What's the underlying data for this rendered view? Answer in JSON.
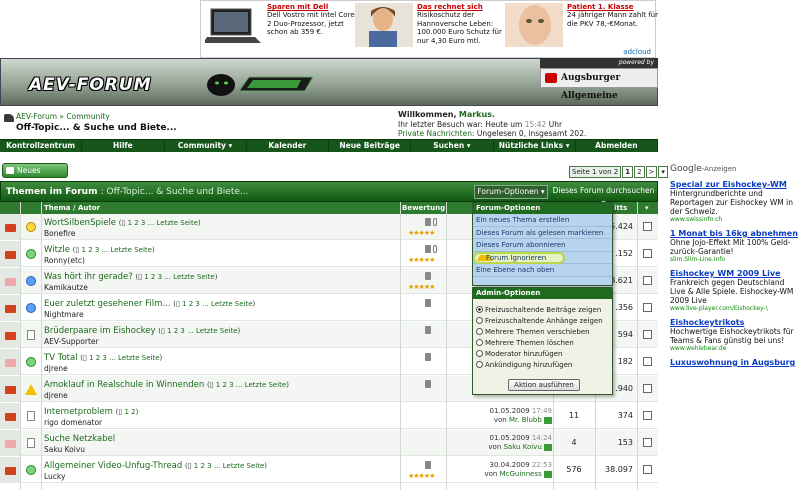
{
  "top_ads": [
    {
      "title": "Sparen mit Dell",
      "text": "Dell Vostro mit Intel Core 2 Duo-Prozessor, jetzt schon ab 359 €."
    },
    {
      "title": "Das rechnet sich",
      "text": "Risikoschutz der Hannoversche Leben: 100.000 Euro Schutz für nur 4,30 Euro mtl."
    },
    {
      "title": "Patient 1. Klasse",
      "text": "24 jähriger Mann zahlt für die PKV 78,-€Monat."
    }
  ],
  "adcloud": "adcloud",
  "header": {
    "logo": "AEV-FORUM",
    "powered_by": "powered by",
    "partner": "Augsburger Allgemeine"
  },
  "breadcrumb": {
    "path": "AEV-Forum » Community",
    "title": "Off-Topic... & Suche und Biete..."
  },
  "welcome": {
    "greeting": "Willkommen,",
    "user": "Markus.",
    "last_visit_label": "Ihr letzter Besuch war: Heute um",
    "last_visit_time": "15:42",
    "last_visit_suffix": "Uhr",
    "pm_label": "Private Nachrichten:",
    "pm_value": "Ungelesen 0, insgesamt 202."
  },
  "nav": [
    "Kontrollzentrum",
    "Hilfe",
    "Community ▾",
    "Kalender",
    "Neue Beiträge",
    "Suchen ▾",
    "Nützliche Links ▾",
    "Abmelden"
  ],
  "new_thread": "Neues Thema",
  "pager": {
    "info": "Seite 1 von 2",
    "pages": [
      "1",
      "2",
      ">",
      "▾"
    ]
  },
  "forum": {
    "title": "Themen im Forum",
    "name": ": Off-Topic... & Suche und Biete...",
    "options": "Forum-Optionen ▾",
    "search": "Dieses Forum durchsuchen ▾"
  },
  "columns": {
    "topic": "Thema / Autor",
    "rating": "Bewertung",
    "views": "itts"
  },
  "threads": [
    {
      "title": "WortSilbenSpiele",
      "pages": "1 2 3 ... Letzte Seite",
      "author": "Bonefire",
      "date": "",
      "time": "",
      "by": "",
      "replies": "",
      "views": "5.424",
      "icon": "smile"
    },
    {
      "title": "Witzle",
      "pages": "1 2 3 ... Letzte Seite",
      "author": "Ronny(etc)",
      "date": "",
      "time": "",
      "by": "",
      "replies": "",
      "views": ".152",
      "icon": "green"
    },
    {
      "title": "Was hört ihr gerade?",
      "pages": "1 2 3 ... Letzte Seite",
      "author": "Kamikautze",
      "date": "",
      "time": "",
      "by": "",
      "replies": "",
      "views": "8.621",
      "icon": "blue"
    },
    {
      "title": "Euer zuletzt gesehener Film...",
      "pages": "1 2 3 ... Letzte Seite",
      "author": "Nightmare",
      "date": "",
      "time": "",
      "by": "",
      "replies": "",
      "views": ".356",
      "icon": "blue"
    },
    {
      "title": "Brüderpaare im Eishockey",
      "pages": "1 2 3 ... Letzte Seite",
      "author": "AEV-Supporter",
      "date": "",
      "time": "",
      "by": "",
      "replies": "",
      "views": "594",
      "icon": "doc"
    },
    {
      "title": "TV Total",
      "pages": "1 2 3 ... Letzte Seite",
      "author": "djrene",
      "date": "",
      "time": "",
      "by": "",
      "replies": "",
      "views": "182",
      "icon": "green"
    },
    {
      "title": "Amoklauf in Realschule in Winnenden",
      "pages": "1 2 3 ... Letzte Seite",
      "author": "djrene",
      "date": "",
      "time": "",
      "by": "",
      "replies": "",
      "views": ".940",
      "icon": "warn"
    },
    {
      "title": "Internetproblem",
      "pages": "1 2",
      "author": "rigo domenator",
      "date": "01.05.2009",
      "time": "17:49",
      "by": "Mr. Blubb",
      "replies": "11",
      "views": "374",
      "icon": "doc"
    },
    {
      "title": "Suche Netzkabel",
      "pages": "",
      "author": "Saku Koivu",
      "date": "01.05.2009",
      "time": "14:24",
      "by": "Saku Koivu",
      "replies": "4",
      "views": "153",
      "icon": "doc"
    },
    {
      "title": "Allgemeiner Video-Unfug-Thread",
      "pages": "1 2 3 ... Letzte Seite",
      "author": "Lucky",
      "date": "30.04.2009",
      "time": "22:53",
      "by": "McGuinness",
      "replies": "576",
      "views": "38.097",
      "icon": "green"
    }
  ],
  "forum_menu": {
    "header": "Forum-Optionen",
    "items": [
      "Ein neues Thema erstellen",
      "Dieses Forum als gelesen markieren",
      "Dieses Forum abonnieren",
      "Forum Ignorieren",
      "Eine Ebene nach oben"
    ]
  },
  "admin_menu": {
    "header": "Admin-Optionen",
    "options": [
      "Freizuschaltende Beiträge zeigen",
      "Freizuschaltende Anhänge zeigen",
      "Mehrere Themen verschieben",
      "Mehrere Themen löschen",
      "Moderator hinzufügen",
      "Ankündigung hinzufügen"
    ],
    "button": "Aktion ausführen"
  },
  "google": {
    "brand": "Google",
    "suffix": "-Anzeigen"
  },
  "side_ads": [
    {
      "title": "Special zur Eishockey-WM",
      "body": "Hintergrundberichte und Reportagen zur Eishockey WM in der Schweiz.",
      "url": "www.swissinfo.ch"
    },
    {
      "title": "1 Monat bis 16kg abnehmen",
      "body": "Ohne Jojo-Effekt Mit 100% Geld-zurück-Garantie!",
      "url": "slim.Slim-Line.info"
    },
    {
      "title": "Eishockey WM 2009 Live",
      "body": "Frankreich gegen Deutschland Live & Alle Spiele. Eishockey-WM 2009 Live",
      "url": "www.live-player.com/Eishockey-\\"
    },
    {
      "title": "Eishockeytrikots",
      "body": "Hochwertige Eishockeytrikots für Teams & Fans günstig bei uns!",
      "url": "www.wehlebear.de"
    },
    {
      "title": "Luxuswohnung in Augsburg",
      "body": "",
      "url": ""
    }
  ]
}
